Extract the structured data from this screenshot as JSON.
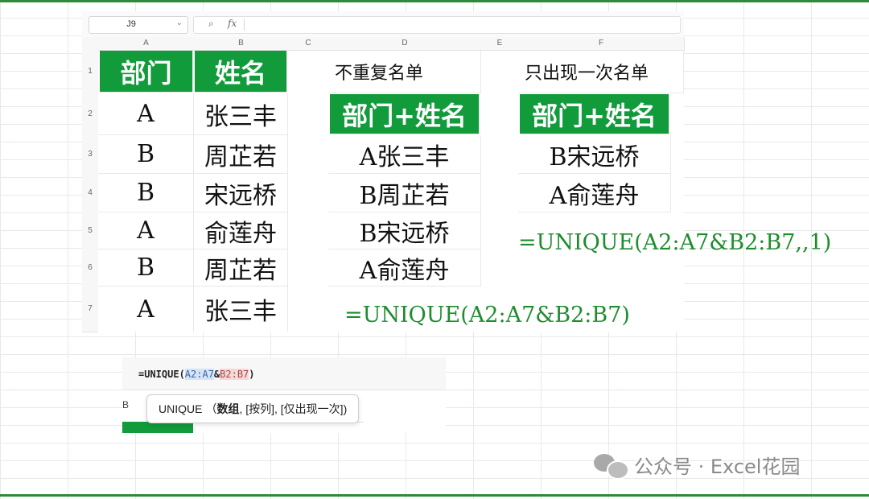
{
  "toolbar": {
    "cell_ref": "J9",
    "fx_label": "fx"
  },
  "columns": [
    "A",
    "B",
    "C",
    "D",
    "E",
    "F"
  ],
  "rows": [
    "1",
    "2",
    "3",
    "4",
    "5",
    "6",
    "7"
  ],
  "headers": {
    "dept": "部门",
    "name": "姓名",
    "unique_label": "不重复名单",
    "once_label": "只出现一次名单",
    "combo_d": "部门+姓名",
    "combo_f": "部门+姓名"
  },
  "table": [
    {
      "dept": "A",
      "name": "张三丰"
    },
    {
      "dept": "B",
      "name": "周芷若"
    },
    {
      "dept": "B",
      "name": "宋远桥"
    },
    {
      "dept": "A",
      "name": "俞莲舟"
    },
    {
      "dept": "B",
      "name": "周芷若"
    },
    {
      "dept": "A",
      "name": "张三丰"
    }
  ],
  "unique_list": [
    "A张三丰",
    "B周芷若",
    "B宋远桥",
    "A俞莲舟"
  ],
  "once_list": [
    "B宋远桥",
    "A俞莲舟"
  ],
  "formulas": {
    "unique": "=UNIQUE(A2:A7&B2:B7)",
    "once": "=UNIQUE(A2:A7&B2:B7,,1)"
  },
  "inset": {
    "prefix": "=UNIQUE(",
    "arg1": "A2:A7",
    "amp": "&",
    "arg2": "B2:B7",
    "suffix": ")",
    "col_label": "B",
    "tooltip_fn": "UNIQUE",
    "tooltip_open": "（",
    "tooltip_arg1": "数组",
    "tooltip_rest": ", [按列], [仅出现一次])"
  },
  "watermark": {
    "text": "公众号 · Excel花园"
  },
  "colors": {
    "accent_green": "#119b3a",
    "formula_green": "#1f8c2e"
  }
}
